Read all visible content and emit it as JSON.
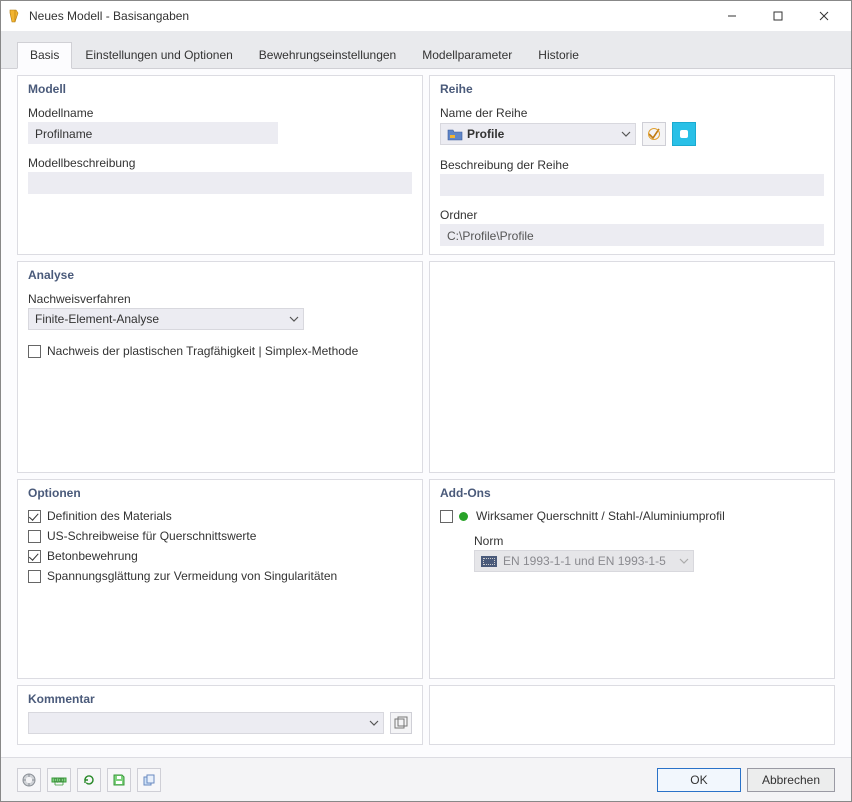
{
  "window": {
    "title": "Neues Modell - Basisangaben",
    "buttons": {
      "min": "—",
      "max": "▢",
      "close": "✕"
    }
  },
  "tabs": [
    {
      "label": "Basis",
      "active": true
    },
    {
      "label": "Einstellungen und Optionen",
      "active": false
    },
    {
      "label": "Bewehrungseinstellungen",
      "active": false
    },
    {
      "label": "Modellparameter",
      "active": false
    },
    {
      "label": "Historie",
      "active": false
    }
  ],
  "left": {
    "model": {
      "title": "Modell",
      "name_label": "Modellname",
      "name_value": "Profilname",
      "desc_label": "Modellbeschreibung",
      "desc_value": ""
    },
    "analysis": {
      "title": "Analyse",
      "method_label": "Nachweisverfahren",
      "method_value": "Finite-Element-Analyse",
      "plastic_check_label": "Nachweis der plastischen Tragfähigkeit | Simplex-Methode",
      "plastic_check_checked": false
    },
    "options": {
      "title": "Optionen",
      "items": [
        {
          "label": "Definition des Materials",
          "checked": true
        },
        {
          "label": "US-Schreibweise für Querschnittswerte",
          "checked": false
        },
        {
          "label": "Betonbewehrung",
          "checked": true
        },
        {
          "label": "Spannungsglättung zur Vermeidung von Singularitäten",
          "checked": false
        }
      ]
    },
    "comment": {
      "title": "Kommentar",
      "value": ""
    }
  },
  "right": {
    "series": {
      "title": "Reihe",
      "name_label": "Name der Reihe",
      "name_value": "Profile",
      "desc_label": "Beschreibung der Reihe",
      "desc_value": "",
      "folder_label": "Ordner",
      "folder_value": "C:\\Profile\\Profile"
    },
    "addons": {
      "title": "Add-Ons",
      "eff_label": "Wirksamer Querschnitt / Stahl-/Aluminiumprofil",
      "eff_checked": false,
      "norm_label": "Norm",
      "norm_value": "EN 1993-1-1 und EN 1993-1-5"
    }
  },
  "footer": {
    "ok": "OK",
    "cancel": "Abbrechen"
  }
}
